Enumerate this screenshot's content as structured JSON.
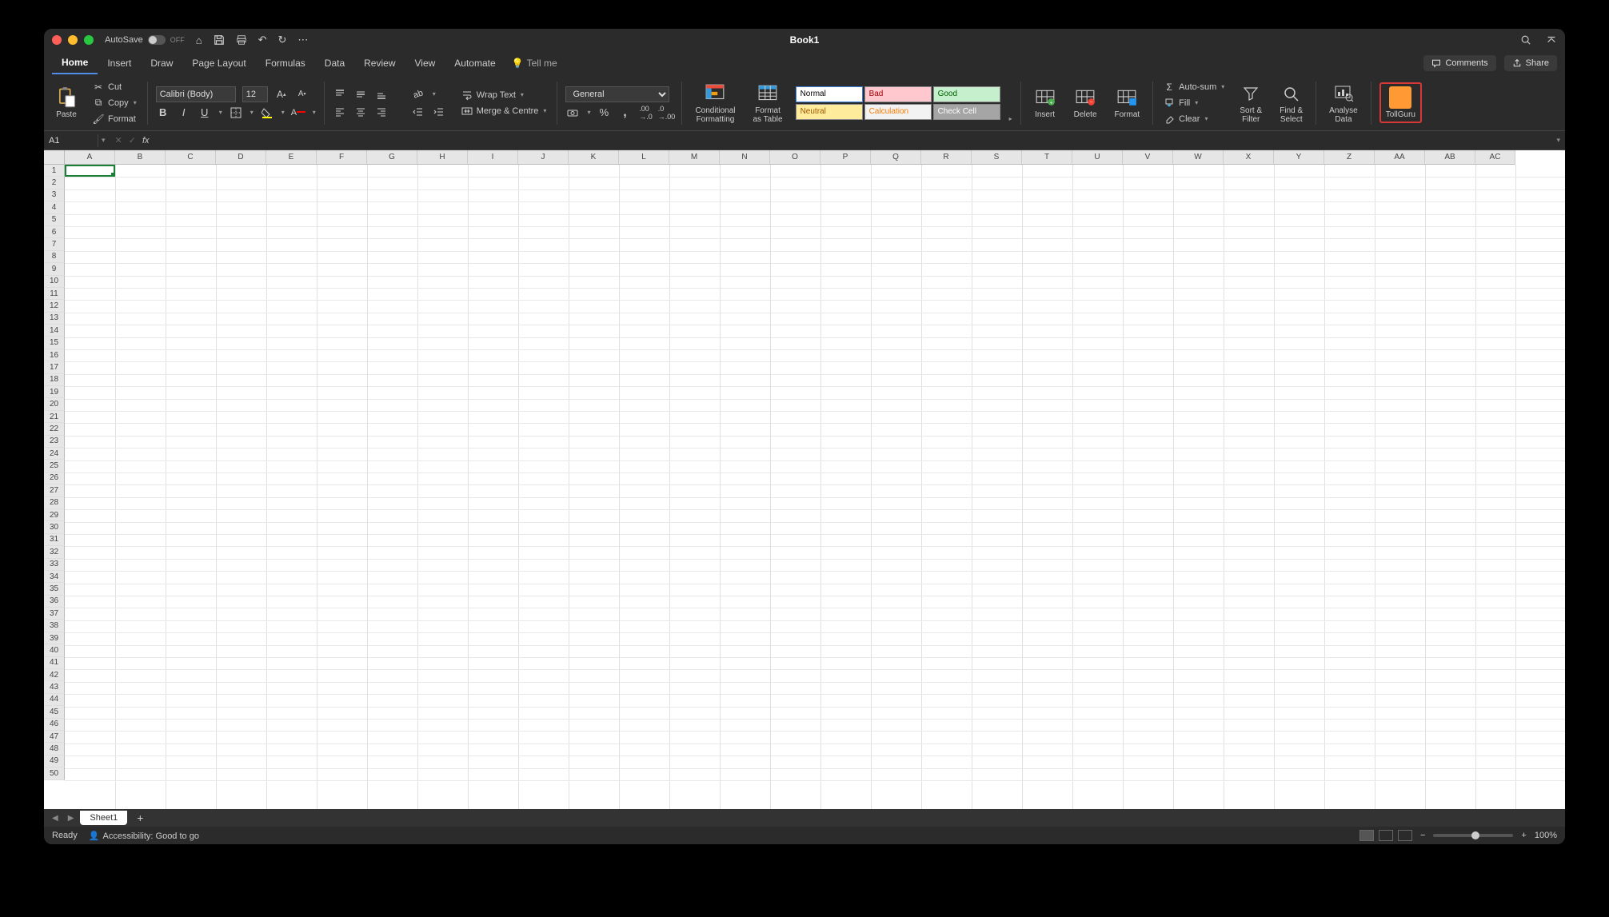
{
  "window_title": "Book1",
  "autosave": {
    "label": "AutoSave",
    "state": "OFF"
  },
  "tabs": [
    "Home",
    "Insert",
    "Draw",
    "Page Layout",
    "Formulas",
    "Data",
    "Review",
    "View",
    "Automate"
  ],
  "active_tab": "Home",
  "tell_me": "Tell me",
  "comments_btn": "Comments",
  "share_btn": "Share",
  "clipboard": {
    "paste": "Paste",
    "cut": "Cut",
    "copy": "Copy",
    "format": "Format"
  },
  "font": {
    "name": "Calibri (Body)",
    "size": "12"
  },
  "alignment": {
    "wrap": "Wrap Text",
    "merge": "Merge & Centre"
  },
  "number": {
    "format": "General"
  },
  "cond_format": "Conditional\nFormatting",
  "format_table": "Format\nas Table",
  "styles": {
    "normal": "Normal",
    "bad": "Bad",
    "good": "Good",
    "neutral": "Neutral",
    "calculation": "Calculation",
    "check": "Check Cell"
  },
  "cells_group": {
    "insert": "Insert",
    "delete": "Delete",
    "format": "Format"
  },
  "editing": {
    "autosum": "Auto-sum",
    "fill": "Fill",
    "clear": "Clear",
    "sort": "Sort &\nFilter",
    "find": "Find &\nSelect"
  },
  "analyse": "Analyse\nData",
  "tollguru": "TollGuru",
  "name_box": "A1",
  "columns": [
    "A",
    "B",
    "C",
    "D",
    "E",
    "F",
    "G",
    "H",
    "I",
    "J",
    "K",
    "L",
    "M",
    "N",
    "O",
    "P",
    "Q",
    "R",
    "S",
    "T",
    "U",
    "V",
    "W",
    "X",
    "Y",
    "Z",
    "AA",
    "AB",
    "AC"
  ],
  "rows": 50,
  "sheet_name": "Sheet1",
  "status": {
    "ready": "Ready",
    "accessibility": "Accessibility: Good to go"
  },
  "zoom": "100%"
}
